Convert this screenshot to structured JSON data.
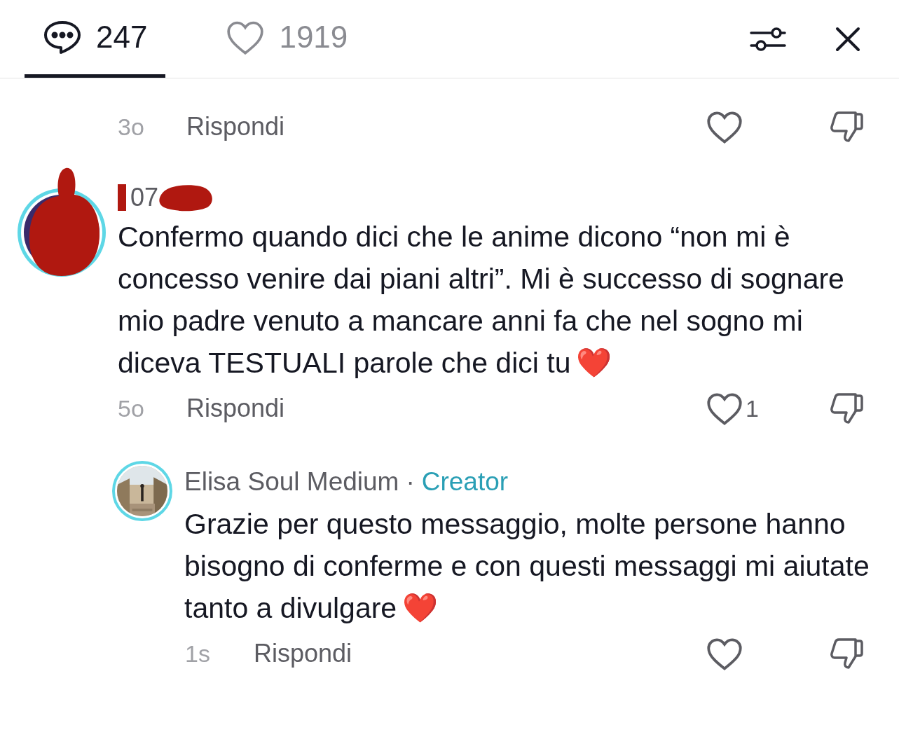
{
  "tabs": [
    {
      "kind": "comments",
      "label": "247",
      "selected": true
    },
    {
      "kind": "likes",
      "label": "1919",
      "selected": false
    }
  ],
  "top_actions": {
    "time": "3o",
    "reply": "Rispondi"
  },
  "comment": {
    "username": "07",
    "text": "Confermo quando dici che le anime dicono “non mi è concesso venire dai piani altri”. Mi è successo di sognare mio padre venuto a mancare anni fa che nel sogno mi diceva TESTUALI parole che dici tu",
    "emoji": "❤️",
    "time": "5o",
    "reply": "Rispondi",
    "like_count": "1"
  },
  "reply": {
    "author": "Elisa Soul Medium",
    "separator": "·",
    "badge": "Creator",
    "text": "Grazie per questo messaggio, molte persone hanno bisogno di conferme e con questi messaggi mi aiutate tanto a divulgare",
    "emoji": "❤️",
    "time": "1s",
    "reply": "Rispondi"
  }
}
